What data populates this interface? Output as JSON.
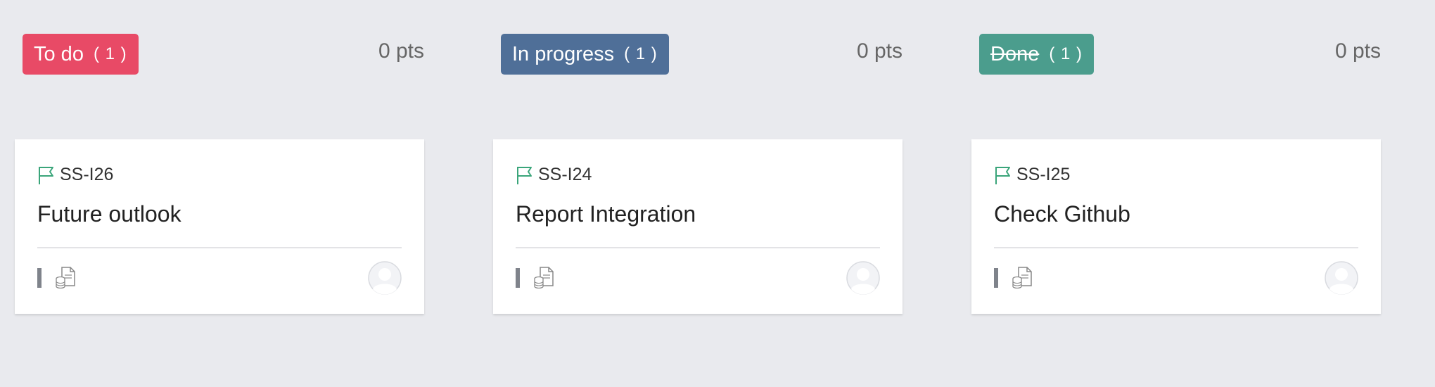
{
  "columns": [
    {
      "status": "To do",
      "count": "( 1 )",
      "points": "0 pts",
      "color": "#e84a66",
      "strikethrough": false,
      "card": {
        "id": "SS-I26",
        "title": "Future outlook"
      }
    },
    {
      "status": "In progress",
      "count": "( 1 )",
      "points": "0 pts",
      "color": "#4f6f98",
      "strikethrough": false,
      "card": {
        "id": "SS-I24",
        "title": "Report Integration"
      }
    },
    {
      "status": "Done",
      "count": "( 1 )",
      "points": "0 pts",
      "color": "#4b9d8d",
      "strikethrough": true,
      "card": {
        "id": "SS-I25",
        "title": "Check Github"
      }
    }
  ],
  "icons": {
    "flag": "flag-icon",
    "document": "document-database-icon",
    "avatar": "user-avatar-icon",
    "priority": "priority-bar"
  },
  "colors": {
    "background": "#e9eaee",
    "flag": "#3aa57a",
    "priority": "#7f838b"
  }
}
